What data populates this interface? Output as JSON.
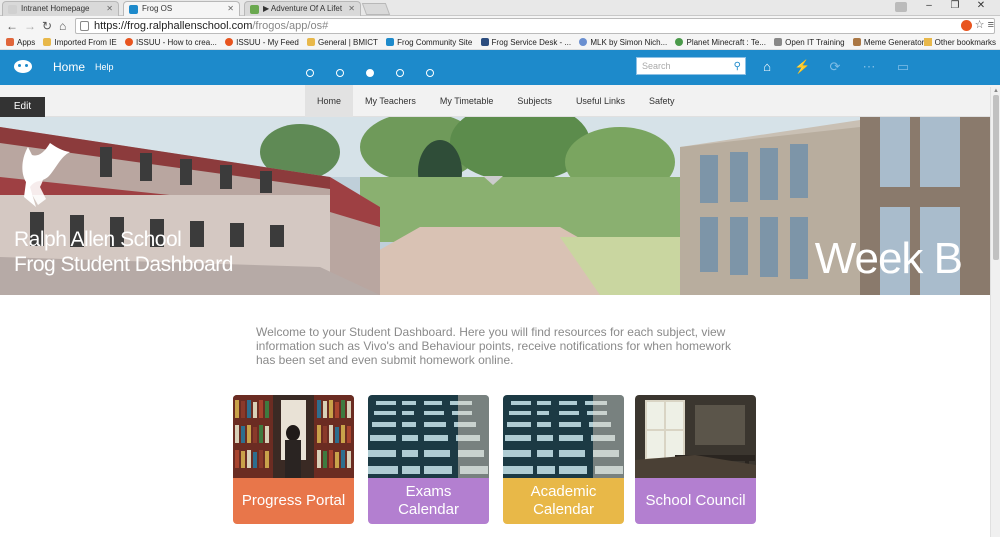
{
  "browser": {
    "tabs": [
      {
        "title": "Intranet Homepage",
        "favicon_color": "#d0d0d0"
      },
      {
        "title": "Frog OS",
        "favicon_color": "#1d8acb"
      },
      {
        "title": "▶ Adventure Of A Lifet",
        "favicon_color": "#6aa84f"
      }
    ],
    "url_host": "https://frog.ralphallenschool.com",
    "url_path": "/frogos/app/os#",
    "bookmarks": [
      {
        "label": "Apps",
        "color": "#e0663b"
      },
      {
        "label": "Imported From IE",
        "color": "#e8b84a"
      },
      {
        "label": "ISSUU - How to crea...",
        "color": "#e8541e"
      },
      {
        "label": "ISSUU - My Feed",
        "color": "#e8541e"
      },
      {
        "label": "General | BMICT",
        "color": "#e8b84a"
      },
      {
        "label": "Frog Community Site",
        "color": "#1d8acb"
      },
      {
        "label": "Frog Service Desk - ...",
        "color": "#2b4c7e"
      },
      {
        "label": "MLK by Simon Nich...",
        "color": "#6a8fd0"
      },
      {
        "label": "Planet Minecraft : Te...",
        "color": "#4a9a4a"
      },
      {
        "label": "Open IT Training",
        "color": "#888888"
      },
      {
        "label": "Meme Generator",
        "color": "#aa7744"
      }
    ],
    "other_bookmarks": "Other bookmarks"
  },
  "frog_bar": {
    "home_label": "Home",
    "help_label": "Help",
    "pager_count": 5,
    "pager_active": 2,
    "search_placeholder": "Search",
    "icons": [
      "home-icon",
      "lightning-icon",
      "refresh-icon",
      "network-icon",
      "chat-icon"
    ]
  },
  "subnav": {
    "edit_label": "Edit",
    "items": [
      "Home",
      "My Teachers",
      "My Timetable",
      "Subjects",
      "Useful Links",
      "Safety"
    ],
    "active": "Home"
  },
  "hero": {
    "title_line1": "Ralph Allen School",
    "title_line2": "Frog Student Dashboard",
    "week_label": "Week B"
  },
  "welcome_text": "Welcome to your Student Dashboard. Here you will find resources for each subject, view information such as Vivo's and Behaviour points, receive notifications for when homework has been set and even submit homework online.",
  "tiles": [
    {
      "label": "Progress Portal",
      "color": "#e8764a",
      "image": "library"
    },
    {
      "label": "Exams Calendar",
      "color": "#b37fd0",
      "image": "departures-board"
    },
    {
      "label": "Academic Calendar",
      "color": "#e8b848",
      "image": "departures-board"
    },
    {
      "label": "School Council",
      "color": "#b37fd0",
      "image": "classroom"
    }
  ],
  "colors": {
    "frog_blue": "#1d8acb"
  }
}
